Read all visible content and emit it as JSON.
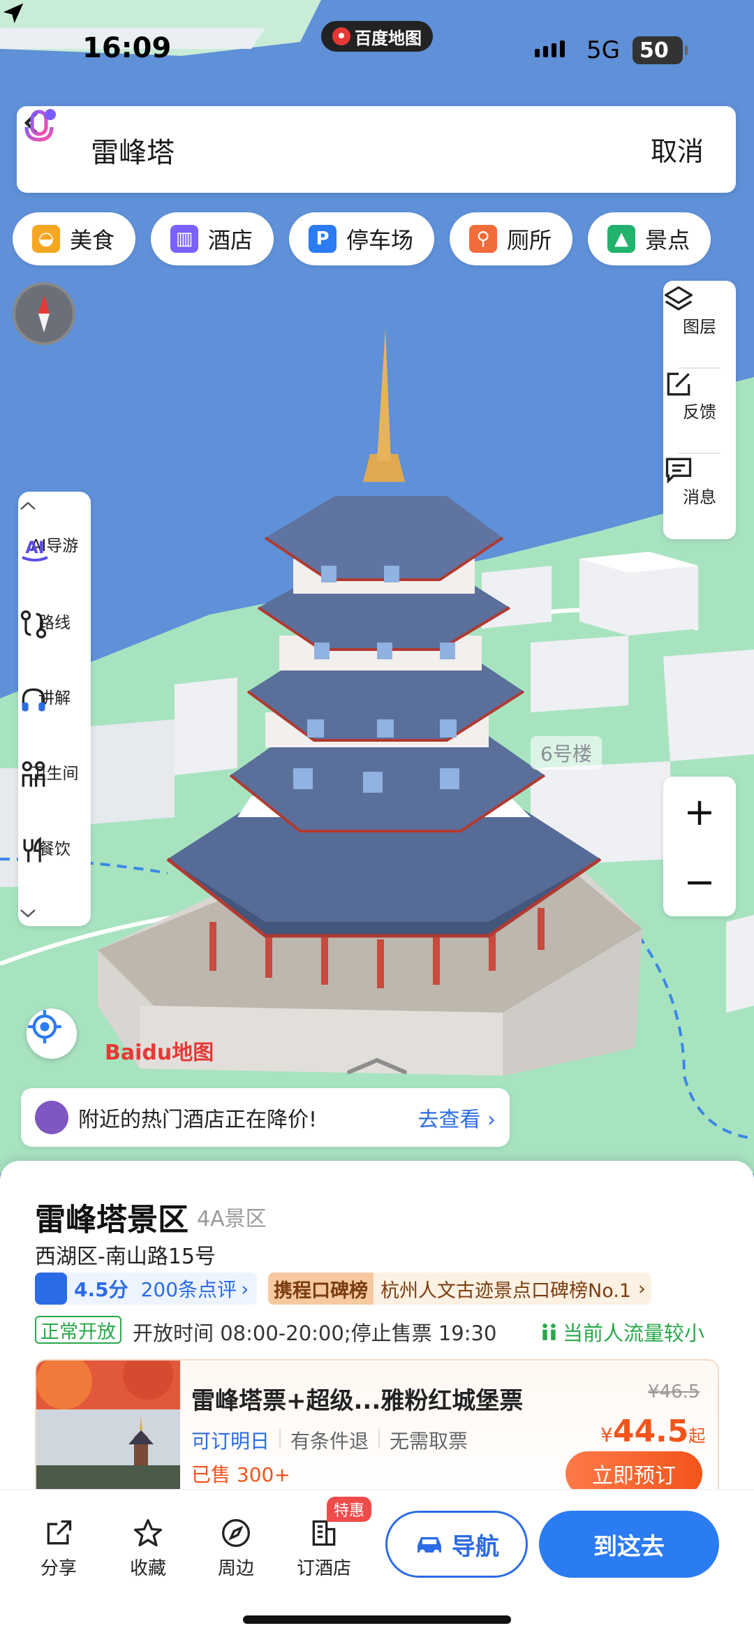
{
  "status_bar": {
    "time": "16:09",
    "app_name": "百度地图",
    "network": "5G",
    "battery": "50"
  },
  "search": {
    "query": "雷峰塔",
    "cancel_label": "取消"
  },
  "categories": [
    {
      "label": "美食",
      "icon": "food-icon",
      "color": "#f5a623"
    },
    {
      "label": "酒店",
      "icon": "hotel-icon",
      "color": "#7b61ff"
    },
    {
      "label": "停车场",
      "icon": "parking-icon",
      "color": "#2b7bf2"
    },
    {
      "label": "厕所",
      "icon": "restroom-icon",
      "color": "#f26b3a"
    },
    {
      "label": "景点",
      "icon": "scenic-icon",
      "color": "#23b26d"
    }
  ],
  "right_tools": [
    {
      "label": "图层",
      "icon": "layers-icon"
    },
    {
      "label": "反馈",
      "icon": "feedback-icon"
    },
    {
      "label": "消息",
      "icon": "message-icon"
    }
  ],
  "left_tools": [
    {
      "label": "AI导游",
      "icon": "ai-guide-icon"
    },
    {
      "label": "路线",
      "icon": "route-icon"
    },
    {
      "label": "讲解",
      "icon": "headphones-icon"
    },
    {
      "label": "卫生间",
      "icon": "restroom-icon"
    },
    {
      "label": "餐饮",
      "icon": "dining-icon"
    }
  ],
  "zoom": {
    "in": "+",
    "out": "−"
  },
  "map": {
    "building_label": "6号楼",
    "logo": "Baidu地图"
  },
  "promo": {
    "text": "附近的热门酒店正在降价!",
    "link": "去查看"
  },
  "poi": {
    "name": "雷峰塔景区",
    "level": "4A景区",
    "address": "西湖区-南山路15号",
    "score": "4.5分",
    "reviews": "200条点评",
    "rank_badge": "携程口碑榜",
    "rank_text": "杭州人文古迹景点口碑榜No.1",
    "status": "正常开放",
    "hours": "开放时间 08:00-20:00;停止售票 19:30",
    "crowd": "当前人流量较小"
  },
  "ticket": {
    "title": "雷峰塔票+超级...雅粉红城堡票",
    "original_price": "¥46.5",
    "currency": "¥",
    "price": "44.5",
    "price_suffix": "起",
    "tag1": "可订明日",
    "tag2": "有条件退",
    "tag3": "无需取票",
    "sold": "已售 300+",
    "book_label": "立即预订"
  },
  "bottom_bar": {
    "share": "分享",
    "favorite": "收藏",
    "nearby": "周边",
    "hotel": "订酒店",
    "hotel_tag": "特惠",
    "navigate": "导航",
    "go": "到这去"
  },
  "colors": {
    "accent": "#2b6be6",
    "price": "#f2541b",
    "open": "#2aa84a"
  }
}
